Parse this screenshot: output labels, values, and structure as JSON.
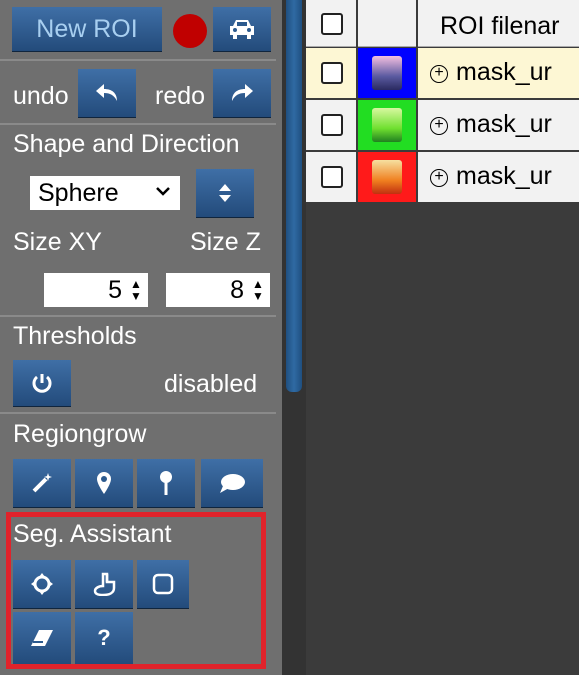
{
  "toolbar": {
    "new_roi_label": "New ROI",
    "record_color": "#c00000",
    "undo_label": "undo",
    "redo_label": "redo"
  },
  "shape": {
    "section_title": "Shape and Direction",
    "selected": "Sphere",
    "size_xy_label": "Size XY",
    "size_z_label": "Size Z",
    "size_xy_value": "5",
    "size_z_value": "8"
  },
  "thresholds": {
    "section_title": "Thresholds",
    "status": "disabled"
  },
  "regiongrow": {
    "section_title": "Regiongrow",
    "icons": [
      "magic-wand-icon",
      "map-pin-icon",
      "push-pin-icon",
      "comment-icon"
    ]
  },
  "seg_assistant": {
    "section_title": "Seg. Assistant",
    "icons": [
      "crosshair-icon",
      "hand-pointer-icon",
      "square-icon",
      "eraser-icon",
      "question-icon"
    ],
    "highlight_color": "#e0232b"
  },
  "table": {
    "header_filename": "ROI filenar",
    "rows": [
      {
        "filename": "mask_ur",
        "color": "#0000ff",
        "bg": "#fdf7d4"
      },
      {
        "filename": "mask_ur",
        "color": "#22dd22",
        "bg": "#f2f2f2"
      },
      {
        "filename": "mask_ur",
        "color": "#ff1a1a",
        "bg": "#f2f2f2"
      }
    ]
  }
}
